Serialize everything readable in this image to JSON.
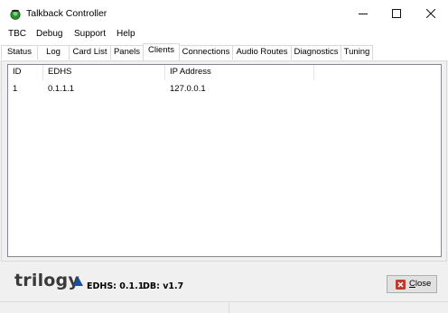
{
  "window": {
    "title": "Talkback Controller",
    "controls": {
      "minimize": "minimize-icon",
      "maximize": "maximize-icon",
      "close": "close-icon"
    }
  },
  "menu": [
    "TBC",
    "Debug",
    "Support",
    "Help"
  ],
  "tabs": [
    {
      "label": "Status"
    },
    {
      "label": "Log"
    },
    {
      "label": "Card List"
    },
    {
      "label": "Panels"
    },
    {
      "label": "Clients",
      "active": true
    },
    {
      "label": "Connections"
    },
    {
      "label": "Audio Routes"
    },
    {
      "label": "Diagnostics"
    },
    {
      "label": "Tuning"
    }
  ],
  "clients_table": {
    "columns": [
      "ID",
      "EDHS",
      "IP Address"
    ],
    "rows": [
      {
        "id": "1",
        "edhs": "0.1.1.1",
        "ip": "127.0.0.1"
      }
    ]
  },
  "footer": {
    "brand": "trilogy",
    "edhs_version": "EDHS: 0.1.1",
    "db_version": "DB: v1.7",
    "close_button": {
      "prefix": "",
      "accel": "C",
      "rest": "lose"
    }
  },
  "colors": {
    "brand_text": "#3a3a3a",
    "brand_mark": "#1a4fa0",
    "close_icon_red": "#c0392b",
    "app_icon_green": "#2e8b2e"
  }
}
